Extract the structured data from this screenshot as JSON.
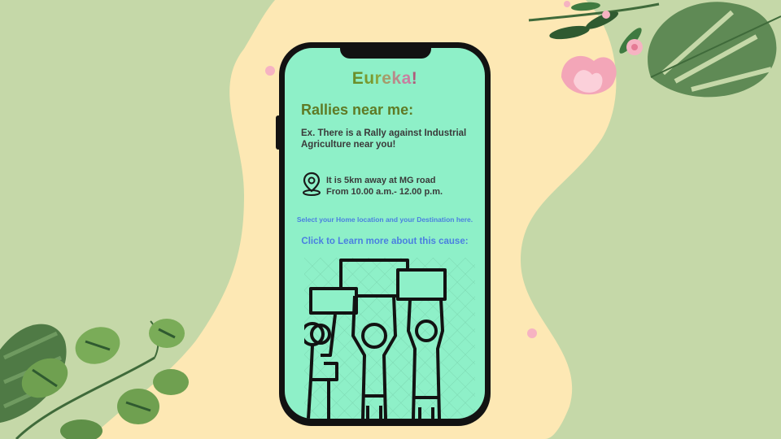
{
  "app": {
    "brand_letters": [
      {
        "ch": "E",
        "color": "#6b8f2a"
      },
      {
        "ch": "u",
        "color": "#7a9a2f"
      },
      {
        "ch": "r",
        "color": "#8aa640"
      },
      {
        "ch": "e",
        "color": "#a59b6a"
      },
      {
        "ch": "k",
        "color": "#b98a8a"
      },
      {
        "ch": "a",
        "color": "#c87fa0"
      },
      {
        "ch": "!",
        "color": "#b05a7a"
      }
    ]
  },
  "main": {
    "title": "Rallies near me:",
    "example_text": "Ex. There is a Rally against Industrial Agriculture near you!",
    "location_line1": "It is 5km away at MG road",
    "location_line2": "From 10.00 a.m.- 12.00 p.m.",
    "home_destination_link": "Select your Home location and your Destination here.",
    "learn_more_link": "Click to Learn more about this cause:"
  },
  "icons": {
    "location": "location-pin-icon",
    "illustration": "protest-illustration"
  },
  "colors": {
    "background": "#c5d8a8",
    "blob": "#fde8b4",
    "screen": "#8ef0c8",
    "title": "#5f7a25",
    "link": "#4a7fe0",
    "body_text": "#3a3a3a"
  }
}
